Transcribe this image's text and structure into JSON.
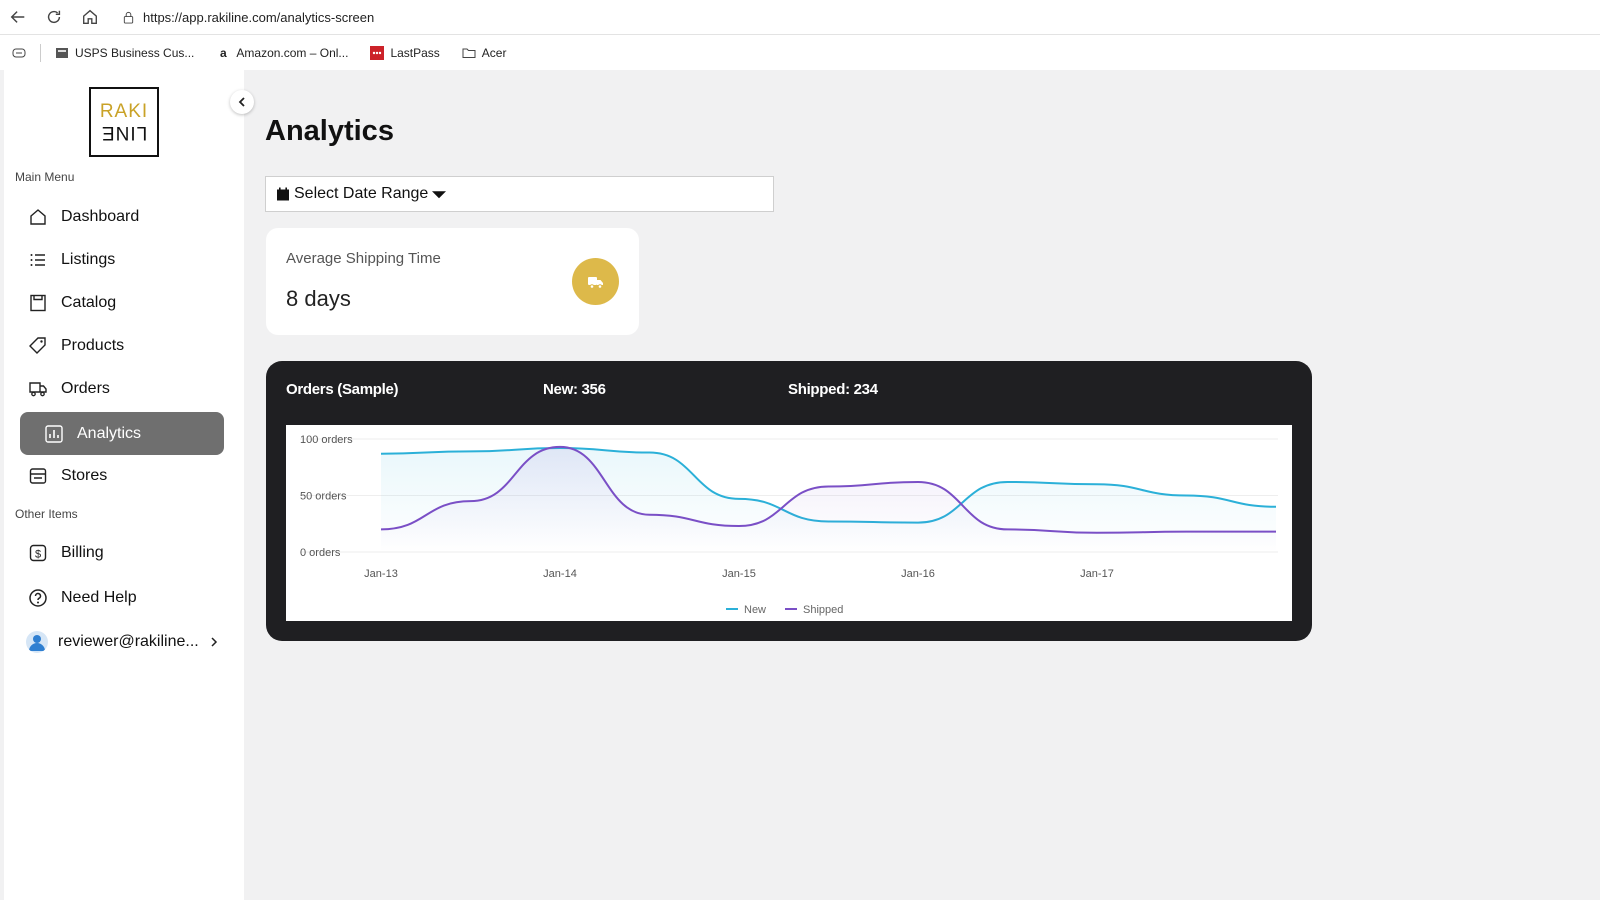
{
  "browser": {
    "url": "https://app.rakiline.com/analytics-screen",
    "bookmarks": [
      "USPS Business Cus...",
      "Amazon.com – Onl...",
      "LastPass",
      "Acer"
    ]
  },
  "sidebar": {
    "logo_top": "RAKI",
    "logo_bottom": "LINE",
    "main_menu_label": "Main Menu",
    "main_items": [
      {
        "label": "Dashboard",
        "icon": "home-icon"
      },
      {
        "label": "Listings",
        "icon": "list-icon"
      },
      {
        "label": "Catalog",
        "icon": "catalog-icon"
      },
      {
        "label": "Products",
        "icon": "tag-icon"
      },
      {
        "label": "Orders",
        "icon": "truck-icon"
      },
      {
        "label": "Analytics",
        "icon": "analytics-icon",
        "active": true
      },
      {
        "label": "Stores",
        "icon": "store-icon"
      }
    ],
    "other_items_label": "Other Items",
    "other_items": [
      {
        "label": "Billing",
        "icon": "dollar-icon"
      },
      {
        "label": "Need Help",
        "icon": "help-icon"
      }
    ],
    "user": "reviewer@rakiline..."
  },
  "main": {
    "title": "Analytics",
    "date_range_label": "Select Date Range",
    "stat": {
      "label": "Average Shipping Time",
      "value": "8 days"
    },
    "chart_header": {
      "title": "Orders (Sample)",
      "new": "New: 356",
      "shipped": "Shipped: 234"
    }
  },
  "colors": {
    "accent": "#ddb94a",
    "active_item": "#6f6f6f",
    "new_series": "#2bb0d8",
    "shipped_series": "#7a4fc6",
    "chart_card": "#1f1f22"
  },
  "chart_data": {
    "type": "line",
    "title": "Orders (Sample)",
    "x": [
      "Jan-13",
      "Jan-13.5",
      "Jan-14",
      "Jan-14.5",
      "Jan-15",
      "Jan-15.5",
      "Jan-16",
      "Jan-16.5",
      "Jan-17",
      "Jan-17.5",
      "Jan-18"
    ],
    "x_ticks": [
      "Jan-13",
      "Jan-14",
      "Jan-15",
      "Jan-16",
      "Jan-17"
    ],
    "y_ticks": [
      "0 orders",
      "50 orders",
      "100 orders"
    ],
    "ylim": [
      0,
      100
    ],
    "series": [
      {
        "name": "New",
        "values": [
          87,
          89,
          92,
          88,
          47,
          27,
          26,
          62,
          60,
          50,
          40
        ]
      },
      {
        "name": "Shipped",
        "values": [
          20,
          45,
          93,
          33,
          23,
          58,
          62,
          20,
          17,
          18,
          18
        ]
      }
    ],
    "legend": "bottom-center",
    "grid": true
  }
}
